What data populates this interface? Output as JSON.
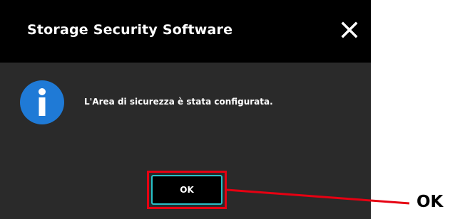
{
  "dialog": {
    "title": "Storage Security Software",
    "close_icon": "close-icon",
    "info_icon": "info-icon",
    "message": "L'Area di sicurezza è stata configurata.",
    "ok_label": "OK"
  },
  "annotation": {
    "callout_label": "OK",
    "highlight_color": "#e60012"
  },
  "colors": {
    "titlebar": "#000000",
    "dialog_body": "#2a2a2a",
    "info_icon": "#1f7ad6",
    "ok_border": "#27c1c8"
  }
}
